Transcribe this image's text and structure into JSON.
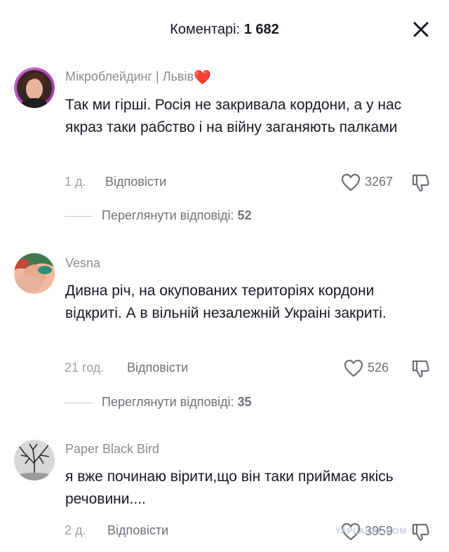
{
  "header": {
    "title_prefix": "Коментарі:",
    "count": "1 682",
    "close_icon": "close-icon"
  },
  "colors": {
    "primary_text": "#161823",
    "secondary_text": "#8a8b91",
    "heart_emoji": "#e0245e"
  },
  "comments": [
    {
      "username": "Мікроблейдинг | Львів",
      "username_emoji": "❤️",
      "text": "Так ми гірші. Росія не закривала кордони, а у нас якраз таки рабство і на війну заганяють палками",
      "timestamp": "1 д.",
      "reply_label": "Відповісти",
      "likes": "3267",
      "view_replies_label": "Переглянути відповіді:",
      "replies_count": "52"
    },
    {
      "username": "Vesna",
      "text": "Дивна річ, на окупованих територіях кордони відкриті. А в вільній незалежній Украіні закриті.",
      "timestamp": "21 год.",
      "reply_label": "Відповісти",
      "likes": "526",
      "view_replies_label": "Переглянути відповіді:",
      "replies_count": "35"
    },
    {
      "username": "Paper Black Bird",
      "text": "я вже починаю вірити,що він таки приймає якісь речовини....",
      "timestamp": "2 д.",
      "reply_label": "Відповісти",
      "likes": "3959"
    }
  ],
  "watermark": "YAPLAKAL.COM"
}
